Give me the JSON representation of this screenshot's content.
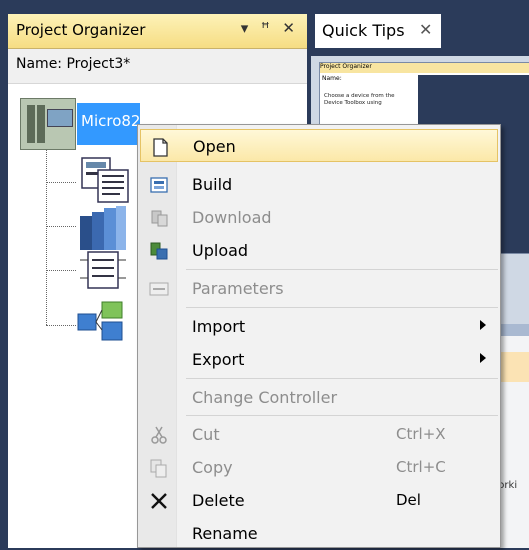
{
  "project_organizer": {
    "title": "Project Organizer",
    "controls": "▾ ꟸ ✕",
    "name_label": "Name:  Project3*",
    "controller_label": "Micro820"
  },
  "quick_tips": {
    "tab_title": "Quick Tips",
    "close": "✕",
    "preview_header": "Project Organizer",
    "preview_name": "Name:",
    "preview_text": "Choose a device from the Device Toolbox using",
    "work_label": "Worki"
  },
  "context_menu": {
    "items": [
      {
        "label": "Open",
        "enabled": true,
        "icon": "open-icon"
      },
      {
        "label": "Build",
        "enabled": true,
        "icon": "build-icon"
      },
      {
        "label": "Download",
        "enabled": false,
        "icon": "download-icon"
      },
      {
        "label": "Upload",
        "enabled": true,
        "icon": "upload-icon"
      },
      {
        "label": "Parameters",
        "enabled": false,
        "icon": "parameters-icon"
      },
      {
        "label": "Import",
        "enabled": true,
        "submenu": true
      },
      {
        "label": "Export",
        "enabled": true,
        "submenu": true
      },
      {
        "label": "Change Controller",
        "enabled": false
      },
      {
        "label": "Cut",
        "enabled": false,
        "shortcut": "Ctrl+X",
        "icon": "scissors-icon"
      },
      {
        "label": "Copy",
        "enabled": false,
        "shortcut": "Ctrl+C",
        "icon": "copy-icon"
      },
      {
        "label": "Delete",
        "enabled": true,
        "shortcut": "Del",
        "icon": "delete-x-icon"
      },
      {
        "label": "Rename",
        "enabled": true
      }
    ]
  },
  "colors": {
    "selection": "#3399ff",
    "pane_header": "#f6dd83",
    "menu_highlight": "#fbe8a8",
    "background": "#2b3b5a"
  }
}
